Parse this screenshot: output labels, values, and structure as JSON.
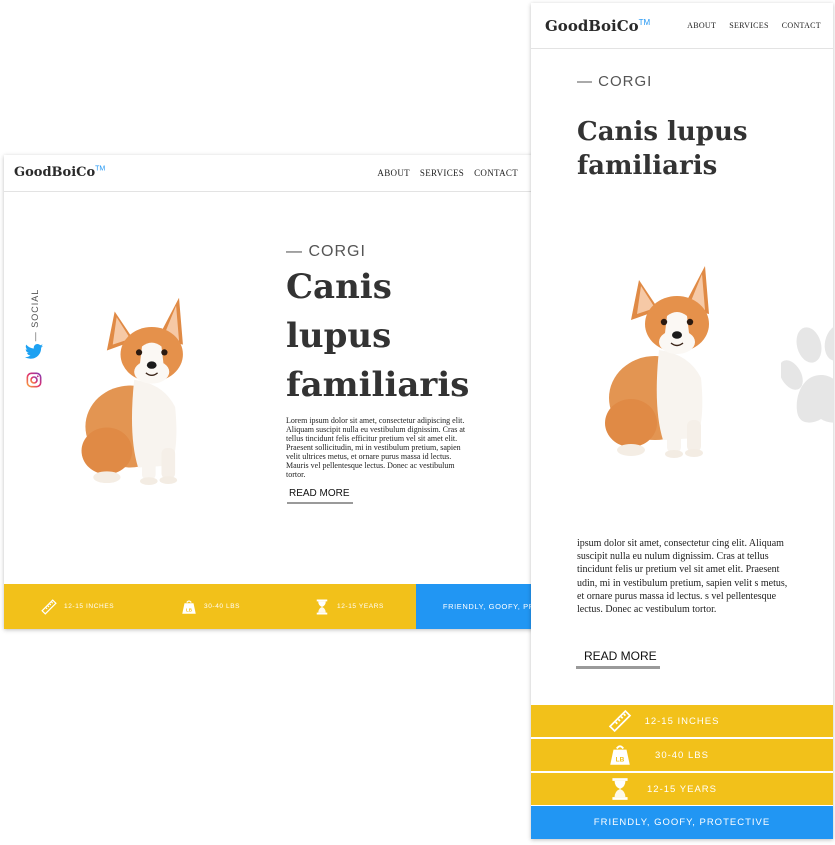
{
  "brand": {
    "name": "GoodBoiCo",
    "trademark": "TM",
    "accent": "#2196f3"
  },
  "nav": [
    "ABOUT",
    "SERVICES",
    "CONTACT"
  ],
  "social": {
    "label": "— SOCIAL",
    "icons": [
      "twitter-icon",
      "instagram-icon"
    ]
  },
  "hero": {
    "eyebrow": "— CORGI",
    "title": "Canis lupus familiaris",
    "body": "Lorem ipsum dolor sit amet, consectetur adipiscing elit. Aliquam suscipit nulla eu vestibulum dignissim. Cras at tellus tincidunt felis efficitur pretium vel sit amet elit. Praesent sollicitudin, mi in vestibulum pretium, sapien velit ultrices metus, et ornare purus massa id lectus. Mauris vel pellentesque lectus. Donec ac vestibulum tortor.",
    "mobile_body": "ipsum dolor sit amet, consectetur cing elit. Aliquam suscipit nulla eu nulum dignissim. Cras at tellus tincidunt felis ur pretium vel sit amet elit. Praesent udin, mi in vestibulum pretium, sapien velit s metus, et ornare purus massa id lectus. s vel pellentesque lectus. Donec ac vestibulum tortor.",
    "cta": "READ MORE"
  },
  "stats": [
    {
      "icon": "ruler-icon",
      "label": "12-15 INCHES"
    },
    {
      "icon": "weight-icon",
      "label": "30-40 LBS",
      "weight_badge": "LB"
    },
    {
      "icon": "hourglass-icon",
      "label": "12-15 YEARS"
    }
  ],
  "traits": "FRIENDLY, GOOFY, PROTECTIVE",
  "colors": {
    "stat_bar": "#f2c11a",
    "traits_bar": "#2196f3",
    "paw": "#e6e6e6",
    "text": "#333333"
  }
}
